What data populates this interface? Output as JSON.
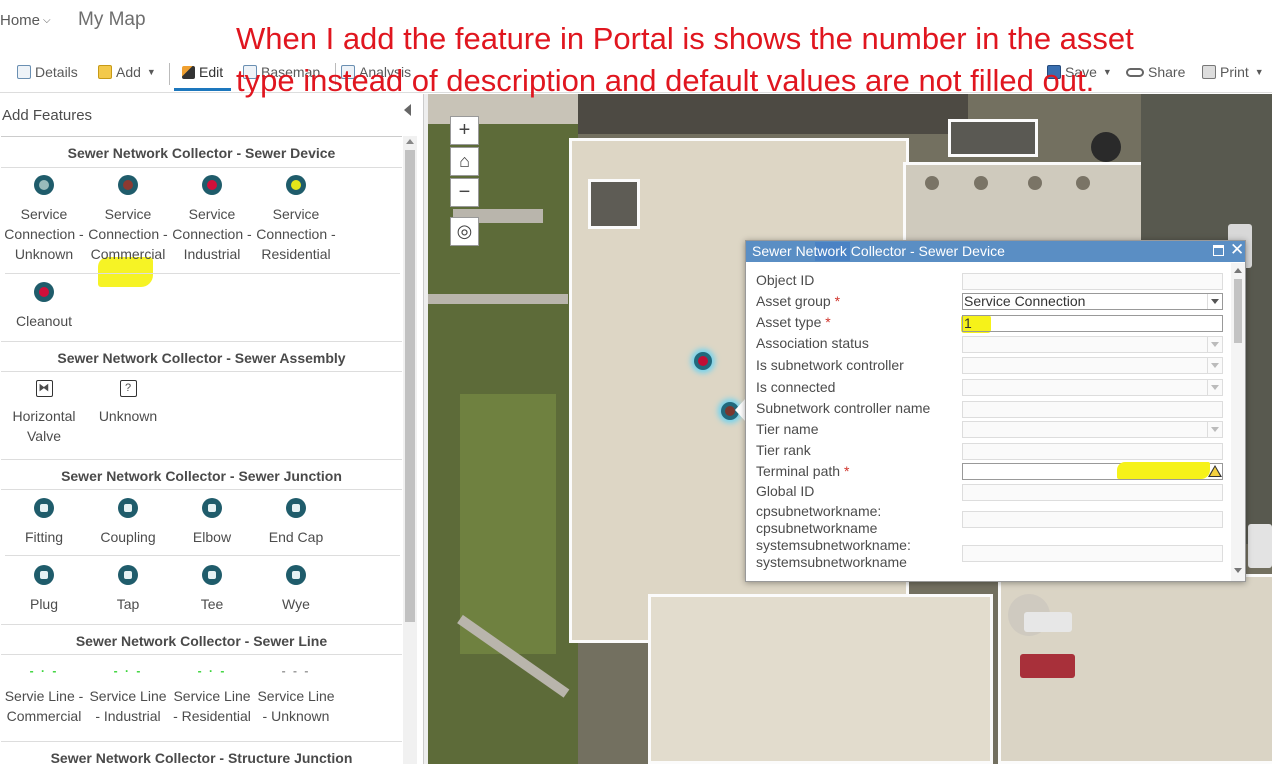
{
  "header": {
    "home": "Home",
    "map_title": "My Map"
  },
  "toolbar": {
    "details": "Details",
    "add": "Add",
    "edit": "Edit",
    "basemap": "Basemap",
    "analysis": "Analysis",
    "save": "Save",
    "share": "Share",
    "print": "Print"
  },
  "panel": {
    "title": "Add Features",
    "groups": [
      {
        "title": "Sewer Network Collector - Sewer Device",
        "items": [
          {
            "line1": "Service",
            "line2": "Connection -",
            "line3": "Unknown",
            "icon": "gray-circle-icon"
          },
          {
            "line1": "Service",
            "line2": "Connection -",
            "line3": "Commercial",
            "icon": "brown-circle-icon"
          },
          {
            "line1": "Service",
            "line2": "Connection -",
            "line3": "Industrial",
            "icon": "red-circle-icon"
          },
          {
            "line1": "Service",
            "line2": "Connection -",
            "line3": "Residential",
            "icon": "yellow-circle-icon"
          },
          {
            "line1": "Cleanout",
            "icon": "red-circle-icon"
          }
        ]
      },
      {
        "title": "Sewer Network Collector - Sewer Assembly",
        "items": [
          {
            "line1": "Horizontal",
            "line2": "Valve",
            "glyph": "⧓"
          },
          {
            "line1": "Unknown",
            "glyph": "?"
          }
        ]
      },
      {
        "title": "Sewer Network Collector - Sewer Junction",
        "items": [
          {
            "line1": "Fitting"
          },
          {
            "line1": "Coupling"
          },
          {
            "line1": "Elbow"
          },
          {
            "line1": "End Cap"
          },
          {
            "line1": "Plug"
          },
          {
            "line1": "Tap"
          },
          {
            "line1": "Tee"
          },
          {
            "line1": "Wye"
          }
        ]
      },
      {
        "title": "Sewer Network Collector - Sewer Line",
        "items": [
          {
            "line1": "Servie Line -",
            "line2": "Commercial",
            "color": "#3cd43c"
          },
          {
            "line1": "Service Line",
            "line2": "- Industrial",
            "color": "#3cd43c"
          },
          {
            "line1": "Service Line",
            "line2": "- Residential",
            "color": "#3cd43c"
          },
          {
            "line1": "Service Line",
            "line2": "- Unknown",
            "color": "#999999"
          }
        ]
      },
      {
        "title": "Sewer Network Collector - Structure Junction"
      }
    ]
  },
  "map_controls": {
    "zoom_in": "+",
    "zoom_out": "−",
    "home": "⌂",
    "locate": "◎"
  },
  "popup": {
    "title": "Sewer Network Collector - Sewer Device",
    "fields": [
      {
        "label": "Object ID",
        "value": ""
      },
      {
        "label": "Asset group",
        "required": "*",
        "value": "Service Connection"
      },
      {
        "label": "Asset type",
        "required": "*",
        "value": "1"
      },
      {
        "label": "Association status",
        "value": ""
      },
      {
        "label": "Is subnetwork controller",
        "value": ""
      },
      {
        "label": "Is connected",
        "value": ""
      },
      {
        "label": "Subnetwork controller name",
        "value": ""
      },
      {
        "label": "Tier name",
        "value": ""
      },
      {
        "label": "Tier rank",
        "value": ""
      },
      {
        "label": "Terminal path",
        "required": "*",
        "value": ""
      },
      {
        "label": "Global ID",
        "value": ""
      },
      {
        "label": "cpsubnetworkname:",
        "label2": "cpsubnetworkname",
        "value": ""
      },
      {
        "label": "systemsubnetworkname:",
        "label2": "systemsubnetworkname",
        "value": ""
      }
    ]
  },
  "annotation": {
    "line1": "When I add the feature in Portal is shows the number in the asset",
    "line2": "type instead of description and default values are not filled out.",
    "color": "#e0161f"
  },
  "colors": {
    "accent": "#1d77bd",
    "popup_header": "#5a8ec4",
    "highlight": "#f6f219"
  }
}
